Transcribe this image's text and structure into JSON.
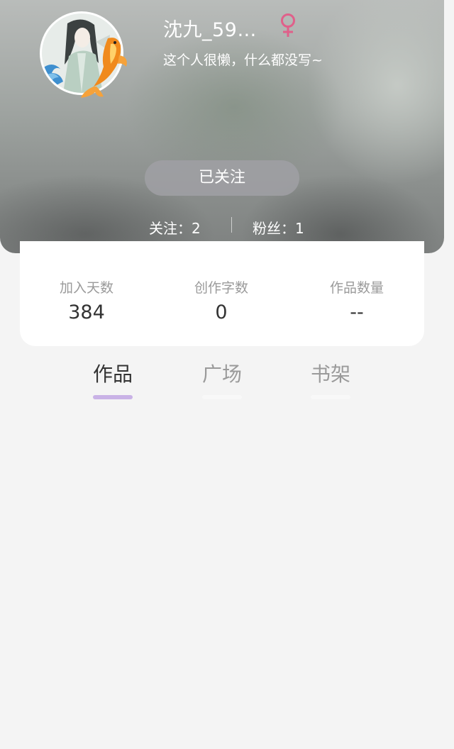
{
  "profile": {
    "name": "沈九_59…",
    "gender_icon": "female-symbol-icon",
    "gender_color": "#e0608a",
    "bio": "这个人很懒，什么都没写~",
    "follow_button_label": "已关注",
    "following": "关注：2",
    "followers": "粉丝：1"
  },
  "stats": [
    {
      "label": "加入天数",
      "value": "384"
    },
    {
      "label": "创作字数",
      "value": "0"
    },
    {
      "label": "作品数量",
      "value": "--"
    }
  ],
  "tabs": [
    {
      "label": "作品",
      "active": true
    },
    {
      "label": "广场",
      "active": false
    },
    {
      "label": "书架",
      "active": false
    }
  ],
  "colors": {
    "accent": "#c9b2e6",
    "tab_active_text": "#333333",
    "tab_inactive_text": "#9a9a9a"
  }
}
